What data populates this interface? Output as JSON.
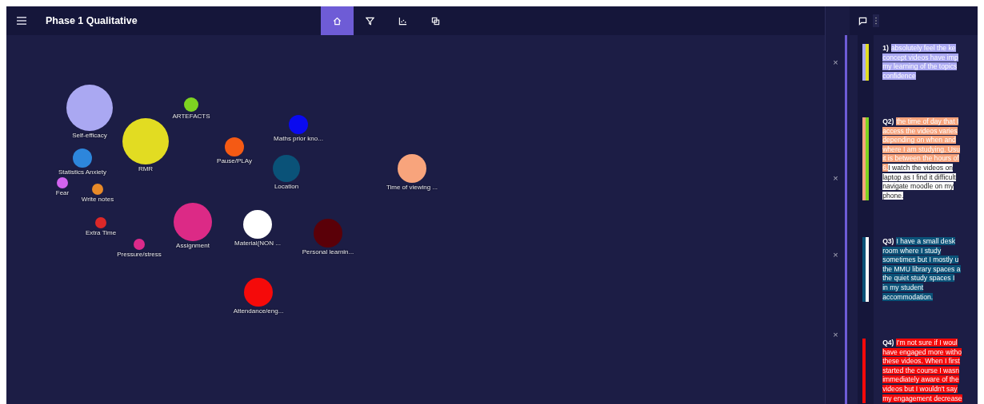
{
  "app_bar": {
    "title": "Phase 1 Qualitative"
  },
  "tabs": [
    {
      "kind": "home",
      "selected": true
    },
    {
      "kind": "filter",
      "selected": false
    },
    {
      "kind": "scatter",
      "selected": false
    },
    {
      "kind": "copy",
      "selected": false
    }
  ],
  "codes": [
    {
      "label": "Self-efficacy",
      "color": "#aaa8f2"
    },
    {
      "label": "ARTEFACTS",
      "color": "#7ed321"
    },
    {
      "label": "RMR",
      "color": "#e2dc22"
    },
    {
      "label": "Maths prior kno...",
      "color": "#0a0af0"
    },
    {
      "label": "Pause/PLAy",
      "color": "#f55a14"
    },
    {
      "label": "Statistics Anxiety",
      "color": "#2d86dc"
    },
    {
      "label": "Location",
      "color": "#0a5278"
    },
    {
      "label": "Time of viewing ...",
      "color": "#f8a47c"
    },
    {
      "label": "Fear",
      "color": "#d264f0"
    },
    {
      "label": "Write notes",
      "color": "#e88a28"
    },
    {
      "label": "Extra Time",
      "color": "#dc2828"
    },
    {
      "label": "Pressure/stress",
      "color": "#dc2a8a"
    },
    {
      "label": "Assignment",
      "color": "#dc2a86"
    },
    {
      "label": "Material(NON ...",
      "color": "#ffffff"
    },
    {
      "label": "Personal learnin...",
      "color": "#5a0008"
    },
    {
      "label": "Attendance/eng...",
      "color": "#f50a0a"
    }
  ],
  "close_buttons": [
    "×",
    "×",
    "×",
    "×"
  ],
  "quotes": [
    {
      "markers": [
        {
          "color": "#aaa8f2"
        },
        {
          "color": "#e2dc22"
        }
      ],
      "lines": [
        [
          {
            "text": "1)"
          },
          {
            "text": "absolutely feel the ke",
            "color": "#aaa8f2"
          }
        ],
        [
          {
            "text": "concept videos have imp",
            "color": "#aaa8f2"
          }
        ],
        [
          {
            "text": "my learning of the topics",
            "color": "#aaa8f2"
          }
        ],
        [
          {
            "text": "confidence",
            "color": "#aaa8f2"
          }
        ]
      ]
    },
    {
      "markers": [
        {
          "color": "#f8a47c"
        },
        {
          "color": "#7ed321"
        }
      ],
      "lines": [
        [
          {
            "text": "Q2)"
          },
          {
            "text": "the time of day that I",
            "color": "#f8a47c"
          }
        ],
        [
          {
            "text": "access the videos varies",
            "color": "#f8a47c"
          }
        ],
        [
          {
            "text": "depending on when and",
            "color": "#f8a47c"
          }
        ],
        [
          {
            "text": "where I am studying. Usu",
            "color": "#f8a47c"
          }
        ],
        [
          {
            "text": "it is between the hours of",
            "color": "#f8a47c"
          }
        ],
        [
          {
            "text": "6.",
            "color": "#f8a47c"
          },
          {
            "text": "I watch the videos on",
            "color": "#ffffff"
          }
        ],
        [
          {
            "text": "laptop as I find it difficult",
            "color": "#ffffff"
          }
        ],
        [
          {
            "text": "navigate moodle on my",
            "color": "#ffffff"
          }
        ],
        [
          {
            "text": "phone.",
            "color": "#ffffff"
          }
        ]
      ]
    },
    {
      "markers": [
        {
          "color": "#0a5278"
        },
        {
          "color": "#ffffff"
        }
      ],
      "lines": [
        [
          {
            "text": "Q3)"
          },
          {
            "text": "I have a small desk",
            "color": "#0a5278"
          }
        ],
        [
          {
            "text": "room where I study",
            "color": "#0a5278"
          }
        ],
        [
          {
            "text": "sometimes but I mostly u",
            "color": "#0a5278"
          }
        ],
        [
          {
            "text": "the MMU library spaces a",
            "color": "#0a5278"
          }
        ],
        [
          {
            "text": "the quiet study spaces I",
            "color": "#0a5278"
          }
        ],
        [
          {
            "text": "in my student",
            "color": "#0a5278"
          }
        ],
        [
          {
            "text": "accommodation.",
            "color": "#0a5278"
          }
        ]
      ]
    },
    {
      "markers": [
        {
          "color": "#f50a0a"
        }
      ],
      "lines": [
        [
          {
            "text": "Q4)"
          },
          {
            "text": "I'm not sure if I woul",
            "color": "#f50a0a"
          }
        ],
        [
          {
            "text": "have engaged more witho",
            "color": "#f50a0a"
          }
        ],
        [
          {
            "text": "these videos. When I first",
            "color": "#f50a0a"
          }
        ],
        [
          {
            "text": "started the course I wasn",
            "color": "#f50a0a"
          }
        ],
        [
          {
            "text": "immediately aware of the",
            "color": "#f50a0a"
          }
        ],
        [
          {
            "text": "videos but I wouldn't say",
            "color": "#f50a0a"
          }
        ],
        [
          {
            "text": "my engagement decrease",
            "color": "#f50a0a"
          }
        ]
      ]
    }
  ]
}
